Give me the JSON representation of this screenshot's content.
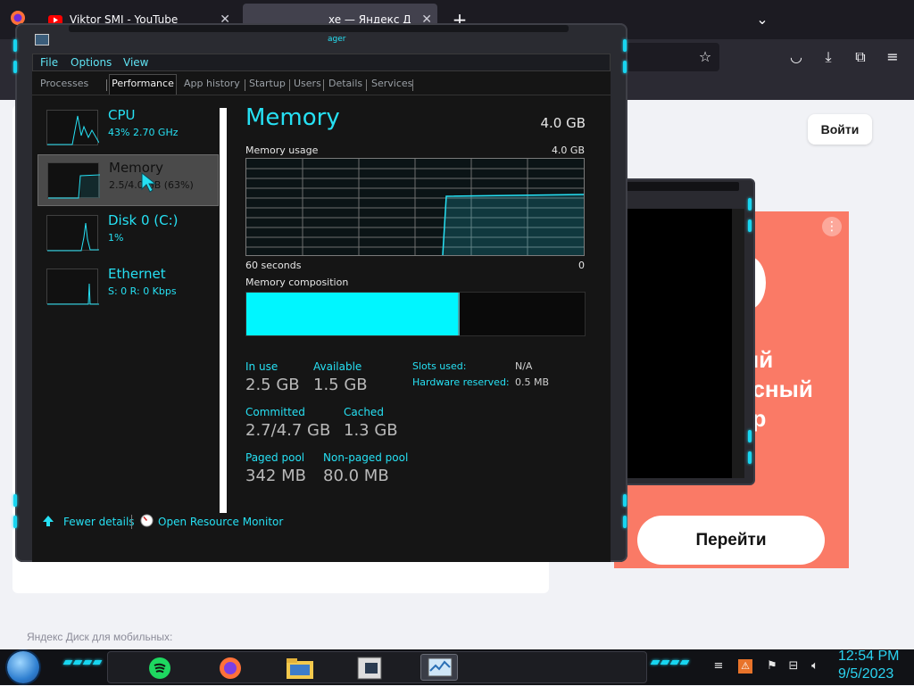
{
  "browser": {
    "tabs": [
      {
        "label": "Viktor SMI - YouTube"
      },
      {
        "label": "xe — Яндекс Д"
      }
    ],
    "new_tab": "+",
    "overlay_tag": "ager"
  },
  "page": {
    "login_label": "Войти",
    "ad_lines": [
      "ый",
      "асный",
      "ер"
    ],
    "ad_go_label": "Перейти",
    "footer_text": "Яндекс Диск для мобильных:"
  },
  "taskmgr": {
    "menu": [
      "File",
      "Options",
      "View"
    ],
    "tabs": [
      "Processes",
      "Performance",
      "App history",
      "Startup",
      "Users",
      "Details",
      "Services"
    ],
    "active_tab": "Performance",
    "resources": [
      {
        "name": "CPU",
        "sub": "43%  2.70 GHz"
      },
      {
        "name": "Memory",
        "sub": "2.5/4.0 GB (63%)"
      },
      {
        "name": "Disk 0 (C:)",
        "sub": "1%"
      },
      {
        "name": "Ethernet",
        "sub": "S: 0  R: 0 Kbps"
      }
    ],
    "selected_resource": "Memory",
    "detail": {
      "title": "Memory",
      "total": "4.0 GB",
      "usage_label": "Memory usage",
      "usage_max": "4.0 GB",
      "time_left": "60 seconds",
      "time_right": "0",
      "composition_label": "Memory composition",
      "composition_used_fraction": 0.63,
      "stats": {
        "in_use_label": "In use",
        "in_use": "2.5 GB",
        "available_label": "Available",
        "available": "1.5 GB",
        "committed_label": "Committed",
        "committed": "2.7/4.7 GB",
        "cached_label": "Cached",
        "cached": "1.3 GB",
        "paged_label": "Paged pool",
        "paged": "342 MB",
        "nonpaged_label": "Non-paged pool",
        "nonpaged": "80.0 MB",
        "slots_label": "Slots used:",
        "slots": "N/A",
        "hw_reserved_label": "Hardware reserved:",
        "hw_reserved": "0.5 MB"
      }
    },
    "footer": {
      "fewer_details": "Fewer details",
      "open_resmon": "Open Resource Monitor"
    }
  },
  "taskbar": {
    "time": "12:54 PM",
    "date": "9/5/2023"
  },
  "colors": {
    "accent": "#26e0f3",
    "composition_fill": "#00f6ff",
    "ad_bg": "#fa7a66"
  }
}
